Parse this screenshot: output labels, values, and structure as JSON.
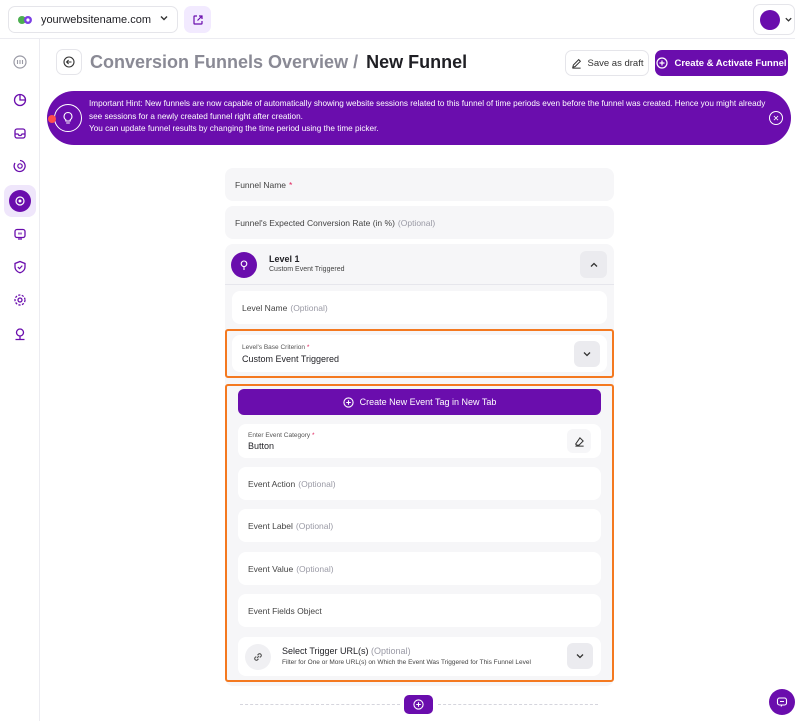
{
  "topbar": {
    "site_name": "yourwebsitename.com",
    "icons": [
      "site-logo-icon",
      "chevron-down-icon",
      "external-link-icon",
      "avatar"
    ]
  },
  "sidebar": {
    "items": [
      {
        "name": "sidebar-item-home",
        "icon": "dashboard-icon"
      },
      {
        "name": "sidebar-item-analytics",
        "icon": "pie-chart-icon"
      },
      {
        "name": "sidebar-item-inbox",
        "icon": "inbox-icon"
      },
      {
        "name": "sidebar-item-goals",
        "icon": "target-icon"
      },
      {
        "name": "sidebar-item-funnels",
        "icon": "funnel-icon",
        "active": true
      },
      {
        "name": "sidebar-item-sessions",
        "icon": "recordings-icon"
      },
      {
        "name": "sidebar-item-security",
        "icon": "shield-icon"
      },
      {
        "name": "sidebar-item-settings",
        "icon": "gear-icon"
      },
      {
        "name": "sidebar-item-locations",
        "icon": "location-icon"
      }
    ]
  },
  "header": {
    "breadcrumb_parent": "Conversion Funnels Overview /",
    "breadcrumb_current": "New Funnel",
    "save_draft_label": "Save as draft",
    "create_label": "Create & Activate Funnel"
  },
  "hint": {
    "line1": "Important Hint: New funnels are now capable of automatically showing website sessions related to this funnel of time periods even before the funnel was created. Hence you might already see sessions for a newly created funnel right after creation.",
    "line2": "You can update funnel results by changing the time period using the time picker."
  },
  "form": {
    "funnel_name_label": "Funnel Name",
    "required_mark": "*",
    "conversion_rate_label": "Funnel's Expected Conversion Rate (in %)",
    "optional": "(Optional)",
    "level": {
      "title": "Level 1",
      "subtitle": "Custom Event Triggered",
      "name_label": "Level Name",
      "criterion_label": "Level's Base Criterion",
      "criterion_value": "Custom Event Triggered",
      "new_tag_button": "Create New Event Tag in New Tab",
      "event_category_label": "Enter Event Category",
      "event_category_value": "Button",
      "event_action_label": "Event Action",
      "event_label_label": "Event Label",
      "event_value_label": "Event Value",
      "event_fields_label": "Event Fields Object",
      "trigger_url_title": "Select Trigger URL(s)",
      "trigger_url_desc": "Filter for One or More URL(s) on Which the Event Was Triggered for This Funnel Level"
    }
  },
  "colors": {
    "accent": "#6a0dad",
    "highlight_border": "#f47920",
    "field_bg": "#f6f6f8"
  }
}
